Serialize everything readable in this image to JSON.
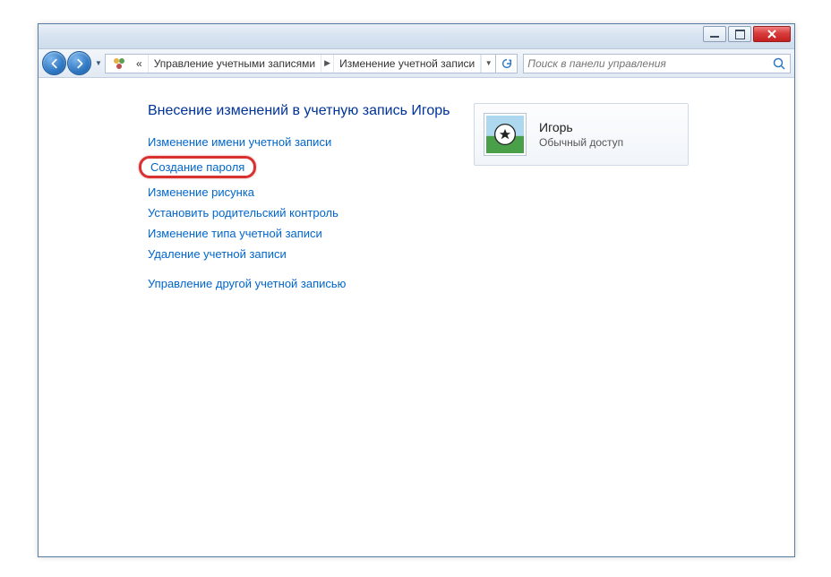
{
  "titlebar": {
    "minimize": "_",
    "maximize": "□",
    "close": "X"
  },
  "breadcrumb": {
    "chevrons": "«",
    "seg1": "Управление учетными записями",
    "seg2": "Изменение учетной записи"
  },
  "search": {
    "placeholder": "Поиск в панели управления"
  },
  "page": {
    "heading": "Внесение изменений в учетную запись Игорь",
    "links": {
      "rename": "Изменение имени учетной записи",
      "create_password": "Создание пароля",
      "change_picture": "Изменение рисунка",
      "parental": "Установить родительский контроль",
      "change_type": "Изменение типа учетной записи",
      "delete": "Удаление учетной записи",
      "manage_other": "Управление другой учетной записью"
    }
  },
  "user": {
    "name": "Игорь",
    "type": "Обычный доступ"
  }
}
